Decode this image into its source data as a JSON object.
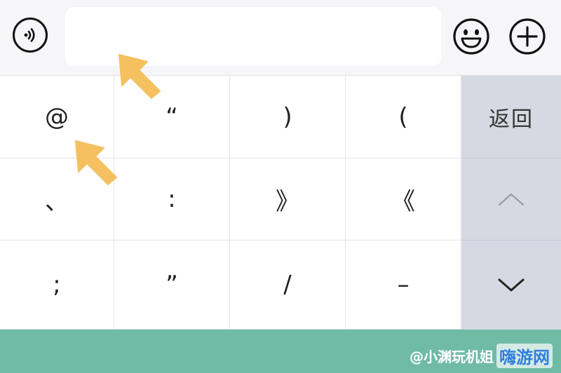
{
  "input_bar": {
    "text_value": "",
    "voice_icon": "voice-wave-icon",
    "emoji_icon": "smiley-face-icon",
    "plus_icon": "plus-circle-icon"
  },
  "keyboard": {
    "rows": [
      [
        "@",
        "“",
        ")",
        "("
      ],
      [
        "、",
        ":",
        "》",
        "《"
      ],
      [
        ";",
        "”",
        "/",
        "–"
      ]
    ],
    "side": {
      "return_label": "返回",
      "up_icon": "chevron-up-icon",
      "down_icon": "chevron-down-icon"
    }
  },
  "colors": {
    "bottom_bar": "#6fbba6",
    "side_column": "#d6d9e2",
    "arrow": "#f5c060"
  },
  "watermark": {
    "author": "@小渊玩机姐",
    "site": "嗨游网"
  }
}
